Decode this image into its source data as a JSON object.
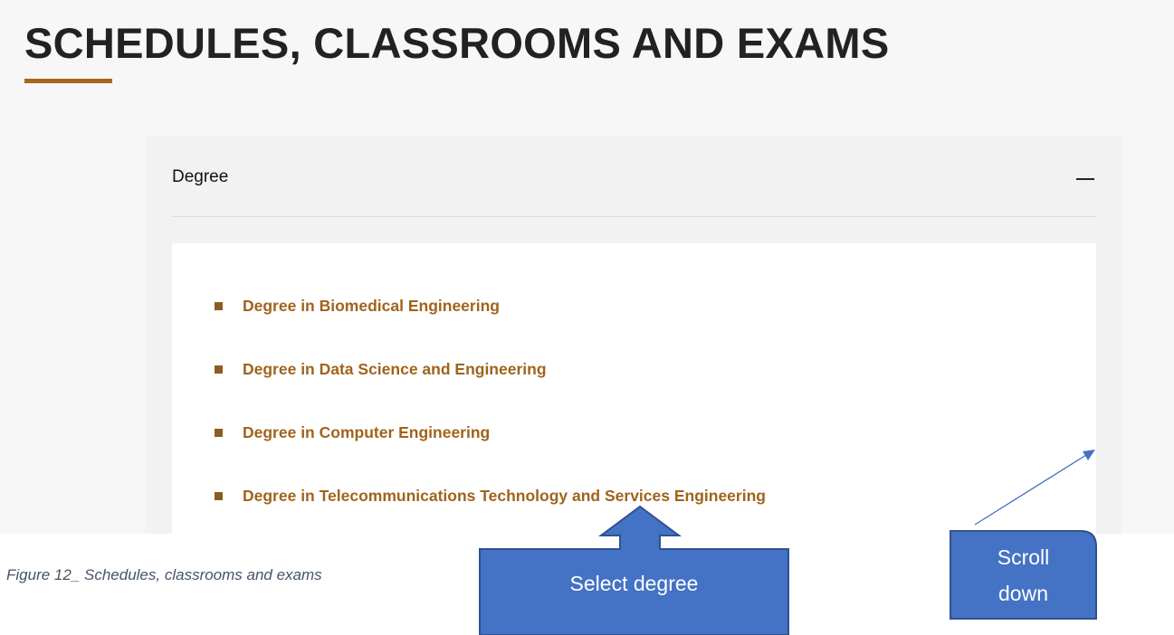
{
  "page": {
    "title": "SCHEDULES, CLASSROOMS AND EXAMS"
  },
  "accordion": {
    "label": "Degree",
    "state_icon": "collapse-icon",
    "items": [
      {
        "label": "Degree in Biomedical Engineering"
      },
      {
        "label": "Degree in Data Science and Engineering"
      },
      {
        "label": "Degree in Computer Engineering"
      },
      {
        "label": "Degree in Telecommunications Technology and Services Engineering"
      }
    ]
  },
  "annotations": {
    "caption": "Figure 12_ Schedules, classrooms and exams",
    "select_callout": "Select degree",
    "scroll_callout_line1": "Scroll",
    "scroll_callout_line2": "down"
  },
  "colors": {
    "accent": "#a0631c",
    "underline": "#a8661a",
    "callout_fill": "#4472c4",
    "callout_stroke": "#2f528f"
  }
}
